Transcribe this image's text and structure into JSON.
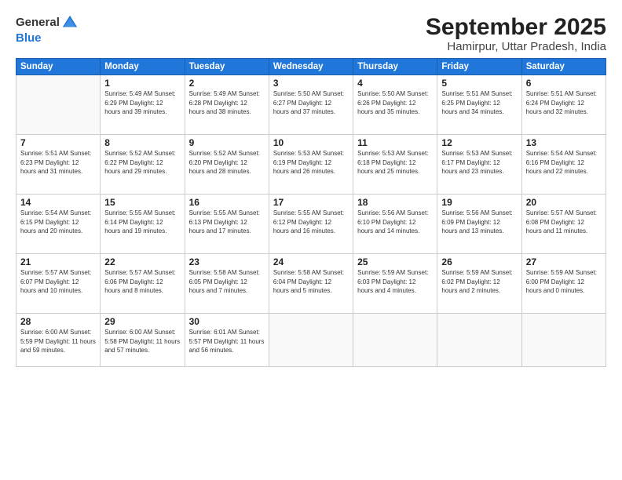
{
  "logo": {
    "line1": "General",
    "line2": "Blue"
  },
  "title": "September 2025",
  "location": "Hamirpur, Uttar Pradesh, India",
  "weekdays": [
    "Sunday",
    "Monday",
    "Tuesday",
    "Wednesday",
    "Thursday",
    "Friday",
    "Saturday"
  ],
  "weeks": [
    [
      {
        "day": "",
        "info": ""
      },
      {
        "day": "1",
        "info": "Sunrise: 5:49 AM\nSunset: 6:29 PM\nDaylight: 12 hours\nand 39 minutes."
      },
      {
        "day": "2",
        "info": "Sunrise: 5:49 AM\nSunset: 6:28 PM\nDaylight: 12 hours\nand 38 minutes."
      },
      {
        "day": "3",
        "info": "Sunrise: 5:50 AM\nSunset: 6:27 PM\nDaylight: 12 hours\nand 37 minutes."
      },
      {
        "day": "4",
        "info": "Sunrise: 5:50 AM\nSunset: 6:26 PM\nDaylight: 12 hours\nand 35 minutes."
      },
      {
        "day": "5",
        "info": "Sunrise: 5:51 AM\nSunset: 6:25 PM\nDaylight: 12 hours\nand 34 minutes."
      },
      {
        "day": "6",
        "info": "Sunrise: 5:51 AM\nSunset: 6:24 PM\nDaylight: 12 hours\nand 32 minutes."
      }
    ],
    [
      {
        "day": "7",
        "info": "Sunrise: 5:51 AM\nSunset: 6:23 PM\nDaylight: 12 hours\nand 31 minutes."
      },
      {
        "day": "8",
        "info": "Sunrise: 5:52 AM\nSunset: 6:22 PM\nDaylight: 12 hours\nand 29 minutes."
      },
      {
        "day": "9",
        "info": "Sunrise: 5:52 AM\nSunset: 6:20 PM\nDaylight: 12 hours\nand 28 minutes."
      },
      {
        "day": "10",
        "info": "Sunrise: 5:53 AM\nSunset: 6:19 PM\nDaylight: 12 hours\nand 26 minutes."
      },
      {
        "day": "11",
        "info": "Sunrise: 5:53 AM\nSunset: 6:18 PM\nDaylight: 12 hours\nand 25 minutes."
      },
      {
        "day": "12",
        "info": "Sunrise: 5:53 AM\nSunset: 6:17 PM\nDaylight: 12 hours\nand 23 minutes."
      },
      {
        "day": "13",
        "info": "Sunrise: 5:54 AM\nSunset: 6:16 PM\nDaylight: 12 hours\nand 22 minutes."
      }
    ],
    [
      {
        "day": "14",
        "info": "Sunrise: 5:54 AM\nSunset: 6:15 PM\nDaylight: 12 hours\nand 20 minutes."
      },
      {
        "day": "15",
        "info": "Sunrise: 5:55 AM\nSunset: 6:14 PM\nDaylight: 12 hours\nand 19 minutes."
      },
      {
        "day": "16",
        "info": "Sunrise: 5:55 AM\nSunset: 6:13 PM\nDaylight: 12 hours\nand 17 minutes."
      },
      {
        "day": "17",
        "info": "Sunrise: 5:55 AM\nSunset: 6:12 PM\nDaylight: 12 hours\nand 16 minutes."
      },
      {
        "day": "18",
        "info": "Sunrise: 5:56 AM\nSunset: 6:10 PM\nDaylight: 12 hours\nand 14 minutes."
      },
      {
        "day": "19",
        "info": "Sunrise: 5:56 AM\nSunset: 6:09 PM\nDaylight: 12 hours\nand 13 minutes."
      },
      {
        "day": "20",
        "info": "Sunrise: 5:57 AM\nSunset: 6:08 PM\nDaylight: 12 hours\nand 11 minutes."
      }
    ],
    [
      {
        "day": "21",
        "info": "Sunrise: 5:57 AM\nSunset: 6:07 PM\nDaylight: 12 hours\nand 10 minutes."
      },
      {
        "day": "22",
        "info": "Sunrise: 5:57 AM\nSunset: 6:06 PM\nDaylight: 12 hours\nand 8 minutes."
      },
      {
        "day": "23",
        "info": "Sunrise: 5:58 AM\nSunset: 6:05 PM\nDaylight: 12 hours\nand 7 minutes."
      },
      {
        "day": "24",
        "info": "Sunrise: 5:58 AM\nSunset: 6:04 PM\nDaylight: 12 hours\nand 5 minutes."
      },
      {
        "day": "25",
        "info": "Sunrise: 5:59 AM\nSunset: 6:03 PM\nDaylight: 12 hours\nand 4 minutes."
      },
      {
        "day": "26",
        "info": "Sunrise: 5:59 AM\nSunset: 6:02 PM\nDaylight: 12 hours\nand 2 minutes."
      },
      {
        "day": "27",
        "info": "Sunrise: 5:59 AM\nSunset: 6:00 PM\nDaylight: 12 hours\nand 0 minutes."
      }
    ],
    [
      {
        "day": "28",
        "info": "Sunrise: 6:00 AM\nSunset: 5:59 PM\nDaylight: 11 hours\nand 59 minutes."
      },
      {
        "day": "29",
        "info": "Sunrise: 6:00 AM\nSunset: 5:58 PM\nDaylight: 11 hours\nand 57 minutes."
      },
      {
        "day": "30",
        "info": "Sunrise: 6:01 AM\nSunset: 5:57 PM\nDaylight: 11 hours\nand 56 minutes."
      },
      {
        "day": "",
        "info": ""
      },
      {
        "day": "",
        "info": ""
      },
      {
        "day": "",
        "info": ""
      },
      {
        "day": "",
        "info": ""
      }
    ]
  ]
}
